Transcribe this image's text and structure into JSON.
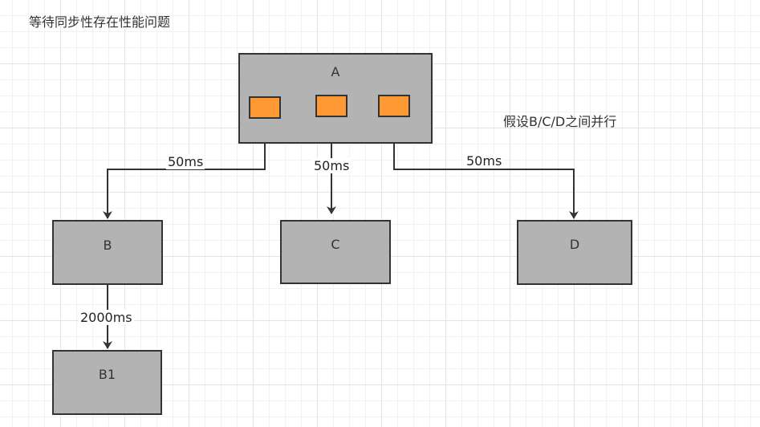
{
  "title": "等待同步性存在性能问题",
  "note": "假设B/C/D之间并行",
  "nodes": {
    "a": "A",
    "b": "B",
    "c": "C",
    "d": "D",
    "b1": "B1"
  },
  "edges": {
    "a_b": "50ms",
    "a_c": "50ms",
    "a_d": "50ms",
    "b_b1": "2000ms"
  },
  "colors": {
    "node_fill": "#b3b3b3",
    "port_fill": "#ff9933",
    "stroke": "#333333"
  }
}
